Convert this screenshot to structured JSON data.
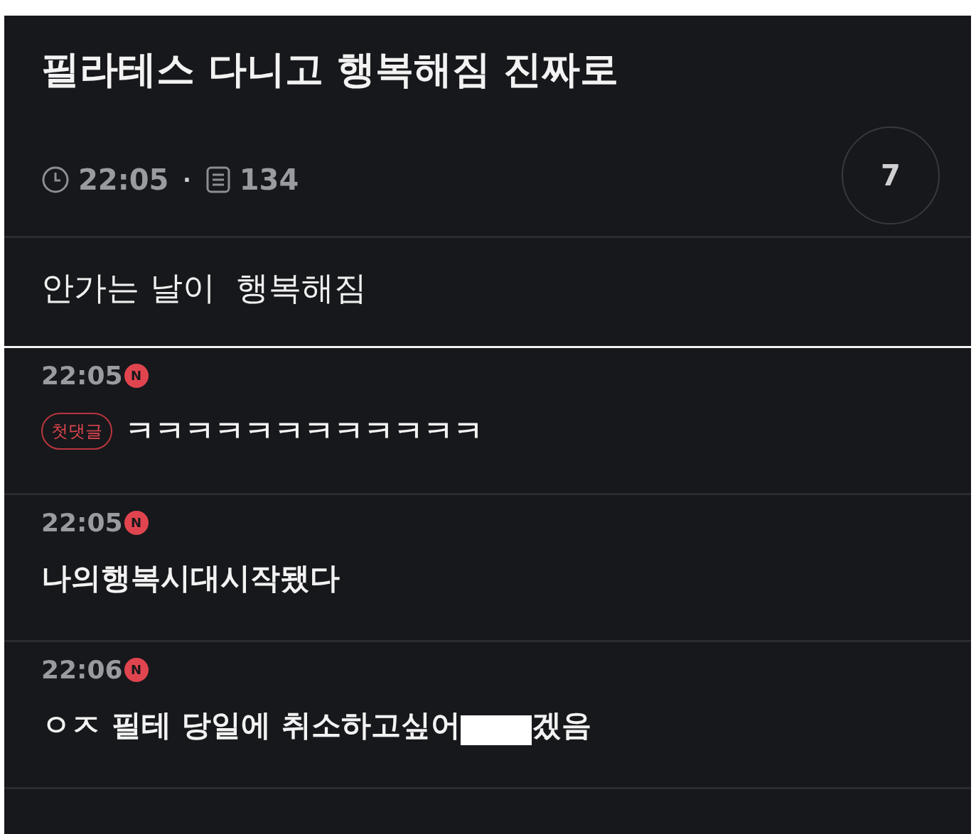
{
  "post": {
    "title": "필라테스 다니고 행복해짐 진짜로",
    "time": "22:05",
    "separator": "·",
    "views": "134",
    "comment_count": "7",
    "body": "안가는 날이  행복해짐"
  },
  "comments": [
    {
      "time": "22:05",
      "new_badge": "N",
      "first_badge": "첫댓글",
      "text": "ㅋㅋㅋㅋㅋㅋㅋㅋㅋㅋㅋㅋ",
      "redacted": false
    },
    {
      "time": "22:05",
      "new_badge": "N",
      "text": "나의행복시대시작됐다",
      "redacted": false
    },
    {
      "time": "22:06",
      "new_badge": "N",
      "text": "ㅇㅈ 필테 당일에 취소하고싶어",
      "redacted": true,
      "text_after": "겠음"
    }
  ]
}
